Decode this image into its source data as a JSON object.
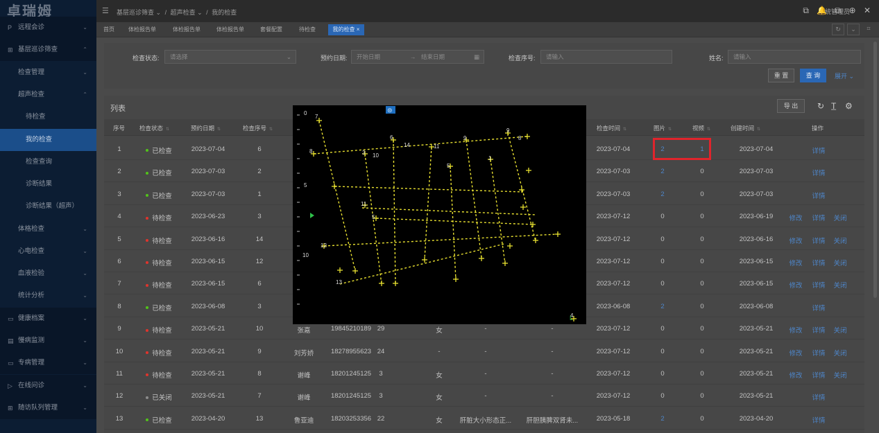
{
  "app": {
    "logo": "卓瑞姆"
  },
  "sidebar": {
    "items": [
      {
        "icon": "P",
        "label": "远程会诊",
        "level": 0,
        "chevron": "⌄",
        "active": false
      },
      {
        "icon": "⊞",
        "label": "基层巡诊筛查",
        "level": 0,
        "chevron": "⌃",
        "active": false
      },
      {
        "icon": "",
        "label": "检查管理",
        "level": 1,
        "chevron": "⌄",
        "active": false
      },
      {
        "icon": "",
        "label": "超声检查",
        "level": 1,
        "chevron": "⌃",
        "active": false
      },
      {
        "icon": "",
        "label": "待检查",
        "level": 2,
        "chevron": "",
        "active": false
      },
      {
        "icon": "",
        "label": "我的检查",
        "level": 2,
        "chevron": "",
        "active": true
      },
      {
        "icon": "",
        "label": "检查查询",
        "level": 2,
        "chevron": "",
        "active": false
      },
      {
        "icon": "",
        "label": "诊断结果",
        "level": 2,
        "chevron": "",
        "active": false
      },
      {
        "icon": "",
        "label": "诊断结果（超声）",
        "level": 2,
        "chevron": "",
        "active": false
      },
      {
        "icon": "",
        "label": "体格检查",
        "level": 1,
        "chevron": "⌄",
        "active": false
      },
      {
        "icon": "",
        "label": "心电检查",
        "level": 1,
        "chevron": "⌄",
        "active": false
      },
      {
        "icon": "",
        "label": "血液检验",
        "level": 1,
        "chevron": "⌄",
        "active": false
      },
      {
        "icon": "",
        "label": "统计分析",
        "level": 1,
        "chevron": "⌄",
        "active": false
      },
      {
        "icon": "▭",
        "label": "健康档案",
        "level": 0,
        "chevron": "⌄",
        "active": false
      },
      {
        "icon": "▤",
        "label": "慢病监测",
        "level": 0,
        "chevron": "⌄",
        "active": false
      },
      {
        "icon": "▭",
        "label": "专病管理",
        "level": 0,
        "chevron": "⌄",
        "active": false
      },
      {
        "icon": "▷",
        "label": "在线问诊",
        "level": 0,
        "chevron": "⌄",
        "active": false
      },
      {
        "icon": "⊞",
        "label": "随访队列管理",
        "level": 0,
        "chevron": "⌄",
        "active": false
      }
    ]
  },
  "header": {
    "menu_icon": "☰",
    "breadcrumb": [
      "基层巡诊筛查 ⌄",
      "/",
      "超声检查 ⌄",
      "/",
      "我的检查"
    ],
    "icons": [
      "⧉",
      "🔔",
      "⧉",
      "⊕",
      "✕"
    ],
    "user": "系统管理员"
  },
  "tabs": [
    {
      "label": "首页",
      "active": false
    },
    {
      "label": "体检报告单",
      "active": false
    },
    {
      "label": "体检报告单",
      "active": false
    },
    {
      "label": "体检报告单",
      "active": false
    },
    {
      "label": "套餐配置",
      "active": false
    },
    {
      "label": "待检查",
      "active": false
    },
    {
      "label": "我的检查 ×",
      "active": true
    }
  ],
  "tab_controls": [
    "↻",
    "⌄",
    "⌗"
  ],
  "search": {
    "status_label": "检查状态:",
    "status_placeholder": "请选择",
    "status_arrow": "⌄",
    "date_label": "预约日期:",
    "date_start": "开始日期",
    "date_arrow": "→",
    "date_end": "结束日期",
    "date_icon": "▦",
    "seq_label": "检查序号:",
    "seq_placeholder": "请输入",
    "name_label": "姓名:",
    "name_placeholder": "请输入",
    "reset": "重 置",
    "query": "查 询",
    "expand": "展开 ⌄"
  },
  "list": {
    "title": "列表",
    "export": "导 出",
    "tools": [
      "↻",
      "T̲",
      "⚙"
    ],
    "columns": {
      "seq": "序号",
      "status": "检查状态",
      "date": "预约日期",
      "num": "检查序号",
      "exam_time": "检查时间",
      "images": "图片",
      "video": "视频",
      "created": "创建时间",
      "ops": "操作"
    },
    "sort_icon": "⇅",
    "rows": [
      {
        "seq": "1",
        "status": "已检查",
        "color": "#52c41a",
        "date": "2023-07-04",
        "num": "6",
        "name": "",
        "phone": "",
        "age": "",
        "sex": "",
        "f1": "",
        "f2": "",
        "exam": "2023-07-04",
        "img": "2",
        "vid": "1",
        "created": "2023-07-04",
        "edit": "",
        "detail": "详情",
        "close": ""
      },
      {
        "seq": "2",
        "status": "已检查",
        "color": "#52c41a",
        "date": "2023-07-03",
        "num": "2",
        "name": "",
        "phone": "",
        "age": "",
        "sex": "",
        "f1": "",
        "f2": "",
        "exam": "2023-07-03",
        "img": "2",
        "vid": "0",
        "created": "2023-07-03",
        "edit": "",
        "detail": "详情",
        "close": ""
      },
      {
        "seq": "3",
        "status": "已检查",
        "color": "#52c41a",
        "date": "2023-07-03",
        "num": "1",
        "name": "",
        "phone": "",
        "age": "",
        "sex": "",
        "f1": "",
        "f2": "",
        "exam": "2023-07-03",
        "img": "2",
        "vid": "0",
        "created": "2023-07-03",
        "edit": "",
        "detail": "详情",
        "close": ""
      },
      {
        "seq": "4",
        "status": "待检查",
        "color": "#e0342c",
        "date": "2023-06-23",
        "num": "3",
        "name": "",
        "phone": "",
        "age": "",
        "sex": "",
        "f1": "",
        "f2": "",
        "exam": "2023-07-12",
        "img": "0",
        "vid": "0",
        "created": "2023-06-19",
        "edit": "修改",
        "detail": "详情",
        "close": "关闭"
      },
      {
        "seq": "5",
        "status": "待检查",
        "color": "#e0342c",
        "date": "2023-06-16",
        "num": "14",
        "name": "",
        "phone": "",
        "age": "",
        "sex": "",
        "f1": "",
        "f2": "",
        "exam": "2023-07-12",
        "img": "0",
        "vid": "0",
        "created": "2023-06-16",
        "edit": "修改",
        "detail": "详情",
        "close": "关闭"
      },
      {
        "seq": "6",
        "status": "待检查",
        "color": "#e0342c",
        "date": "2023-06-15",
        "num": "12",
        "name": "",
        "phone": "",
        "age": "",
        "sex": "",
        "f1": "",
        "f2": "",
        "exam": "2023-07-12",
        "img": "0",
        "vid": "0",
        "created": "2023-06-15",
        "edit": "修改",
        "detail": "详情",
        "close": "关闭"
      },
      {
        "seq": "7",
        "status": "待检查",
        "color": "#e0342c",
        "date": "2023-06-15",
        "num": "6",
        "name": "",
        "phone": "",
        "age": "",
        "sex": "",
        "f1": "",
        "f2": "",
        "exam": "2023-07-12",
        "img": "0",
        "vid": "0",
        "created": "2023-06-15",
        "edit": "修改",
        "detail": "详情",
        "close": "关闭"
      },
      {
        "seq": "8",
        "status": "已检查",
        "color": "#52c41a",
        "date": "2023-06-08",
        "num": "3",
        "name": "",
        "phone": "",
        "age": "",
        "sex": "",
        "f1": "",
        "f2": "",
        "exam": "2023-06-08",
        "img": "2",
        "vid": "0",
        "created": "2023-06-08",
        "edit": "",
        "detail": "详情",
        "close": ""
      },
      {
        "seq": "9",
        "status": "待检查",
        "color": "#e0342c",
        "date": "2023-05-21",
        "num": "10",
        "name": "张嘉",
        "phone": "19845210189",
        "age": "29",
        "sex": "女",
        "f1": "-",
        "f2": "-",
        "exam": "2023-07-12",
        "img": "0",
        "vid": "0",
        "created": "2023-05-21",
        "edit": "修改",
        "detail": "详情",
        "close": "关闭"
      },
      {
        "seq": "10",
        "status": "待检查",
        "color": "#e0342c",
        "date": "2023-05-21",
        "num": "9",
        "name": "刘芳娇",
        "phone": "18278955623",
        "age": "24",
        "sex": "-",
        "f1": "-",
        "f2": "-",
        "exam": "2023-07-12",
        "img": "0",
        "vid": "0",
        "created": "2023-05-21",
        "edit": "修改",
        "detail": "详情",
        "close": "关闭"
      },
      {
        "seq": "11",
        "status": "待检查",
        "color": "#e0342c",
        "date": "2023-05-21",
        "num": "8",
        "name": "谢峰",
        "phone": "18201245125",
        "age": "3",
        "sex": "女",
        "f1": "-",
        "f2": "-",
        "exam": "2023-07-12",
        "img": "0",
        "vid": "0",
        "created": "2023-05-21",
        "edit": "修改",
        "detail": "详情",
        "close": "关闭"
      },
      {
        "seq": "12",
        "status": "已关闭",
        "color": "#8c8c8c",
        "date": "2023-05-21",
        "num": "7",
        "name": "谢峰",
        "phone": "18201245125",
        "age": "3",
        "sex": "女",
        "f1": "-",
        "f2": "-",
        "exam": "2023-07-12",
        "img": "0",
        "vid": "0",
        "created": "2023-05-21",
        "edit": "",
        "detail": "详情",
        "close": ""
      },
      {
        "seq": "13",
        "status": "已检查",
        "color": "#52c41a",
        "date": "2023-04-20",
        "num": "13",
        "name": "鲁亚迪",
        "phone": "18203253356",
        "age": "22",
        "sex": "女",
        "f1": "肝脏大小形态正...",
        "f2": "肝胆胰脾双肾未...",
        "exam": "2023-05-18",
        "img": "2",
        "vid": "0",
        "created": "2023-04-20",
        "edit": "",
        "detail": "详情",
        "close": ""
      }
    ]
  },
  "viewer": {
    "top_icon": "⊜",
    "scale_labels": [
      "0",
      "5",
      "10"
    ],
    "point_labels": [
      "7",
      "8",
      "3",
      "6",
      "9",
      "9",
      "10",
      "11",
      "1",
      "5",
      "11",
      "5",
      "12",
      "13",
      "4",
      "8",
      "14"
    ],
    "bottom_label": "L"
  }
}
